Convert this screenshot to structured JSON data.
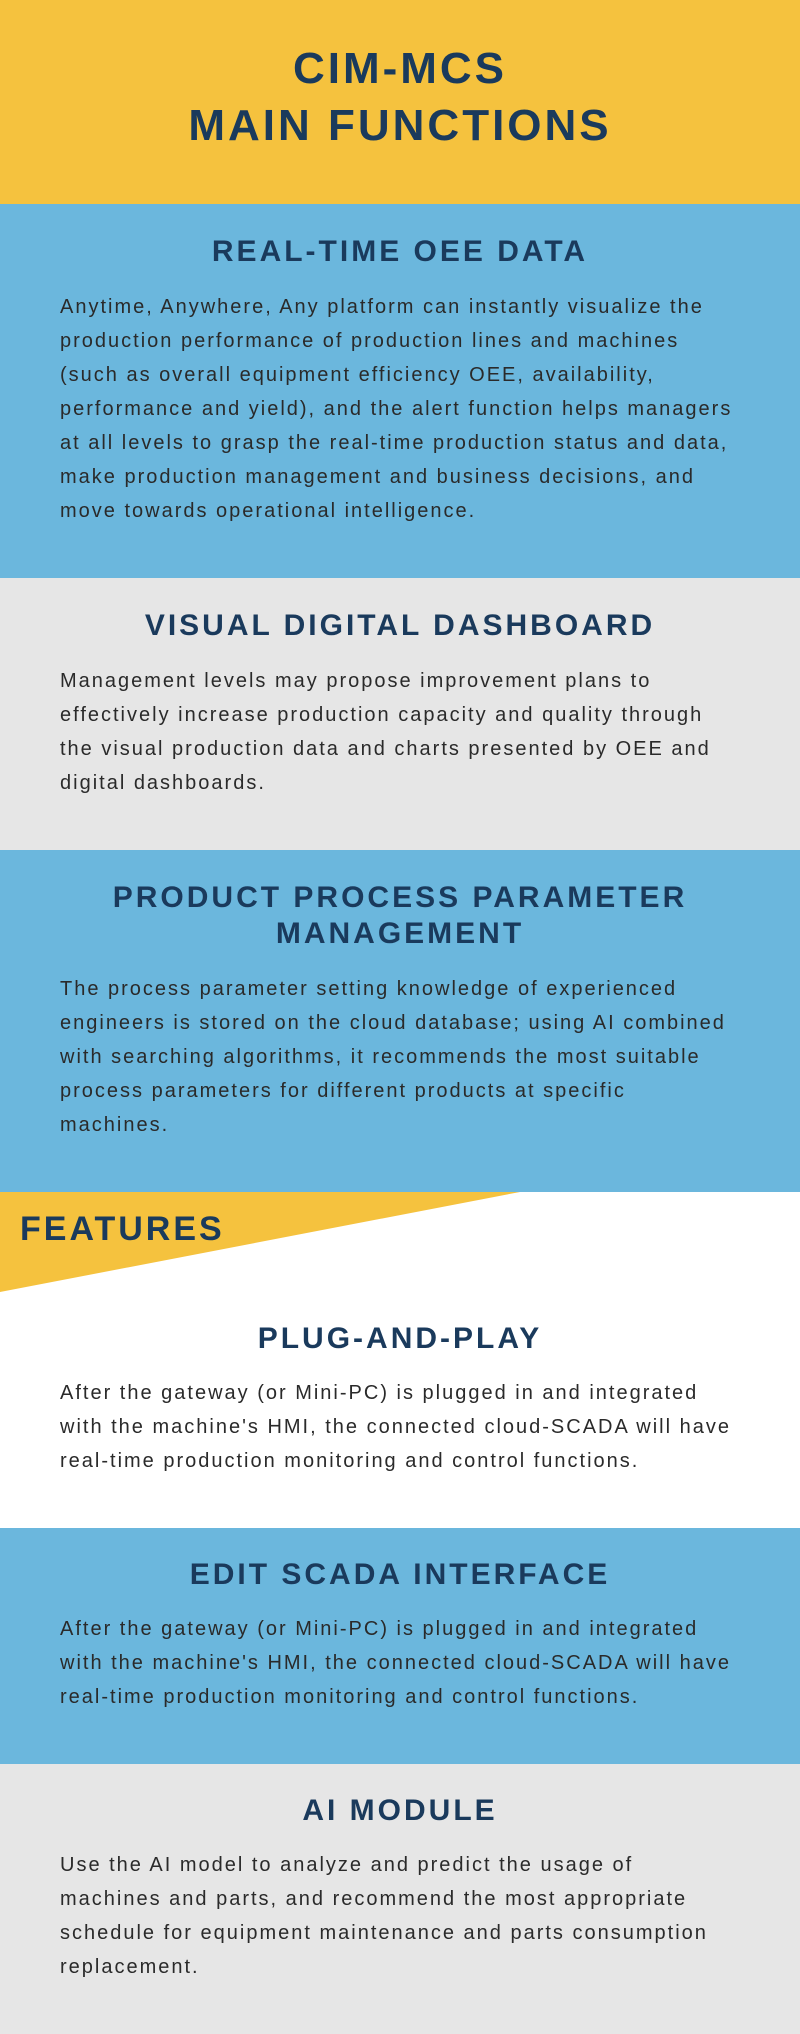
{
  "header": {
    "line1": "CIM-MCS",
    "line2": "MAIN FUNCTIONS"
  },
  "sections": [
    {
      "title": "REAL-TIME OEE DATA",
      "body": "Anytime, Anywhere, Any platform can instantly visualize the production performance of production lines and machines (such as overall equipment efficiency OEE, availability, performance and yield), and the alert function helps managers at all levels to grasp the real-time production status and data, make production management and business decisions, and move towards operational intelligence."
    },
    {
      "title": "VISUAL DIGITAL DASHBOARD",
      "body": "Management levels may propose improvement plans to effectively increase production capacity and quality through the visual production data and charts presented by OEE and digital dashboards."
    },
    {
      "title": "PRODUCT PROCESS PARAMETER MANAGEMENT",
      "body": "The process parameter setting knowledge of experienced engineers is stored on the cloud database; using AI combined with searching algorithms, it recommends the most suitable process parameters for different products at specific machines."
    }
  ],
  "features_label": "FEATURES",
  "features": [
    {
      "title": "PLUG-AND-PLAY",
      "body": "After the gateway (or Mini-PC) is plugged in and integrated with the machine's HMI, the connected cloud-SCADA will have real-time production monitoring and control functions."
    },
    {
      "title": "EDIT SCADA INTERFACE",
      "body": "After the gateway (or Mini-PC) is plugged in and integrated with the machine's HMI, the connected cloud-SCADA will have real-time production monitoring and control functions."
    },
    {
      "title": "AI MODULE",
      "body": "Use the AI model to analyze and predict the usage of machines and parts, and recommend the most appropriate schedule for equipment maintenance and parts consumption replacement."
    }
  ]
}
